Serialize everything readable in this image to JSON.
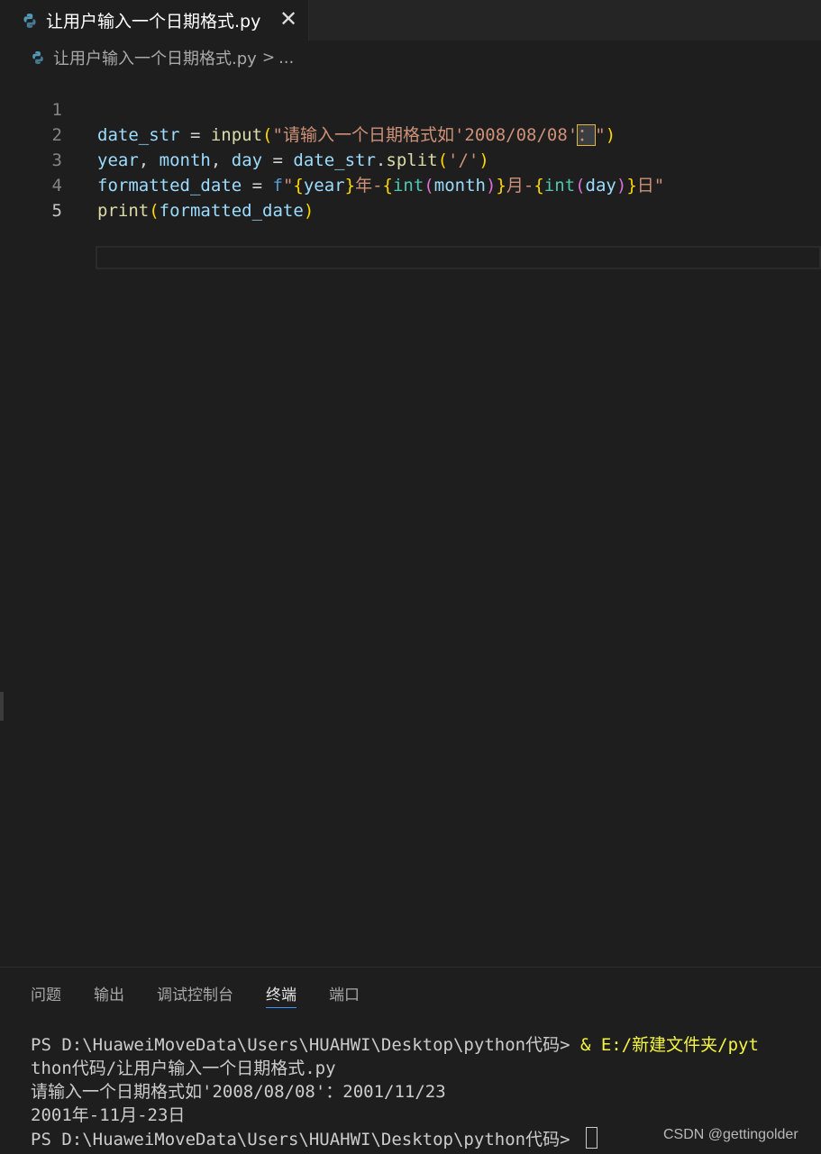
{
  "tab": {
    "title": "让用户输入一个日期格式.py",
    "close_glyph": "✕"
  },
  "breadcrumb": {
    "file": "让用户输入一个日期格式.py",
    "separator": ">",
    "more": "..."
  },
  "editor": {
    "line_numbers": [
      "1",
      "2",
      "3",
      "4",
      "5"
    ],
    "lines": {
      "l1": {
        "a": "date_str",
        "b": " = ",
        "c": "input",
        "d": "(",
        "e": "\"请输入一个日期格式如'2008/08/08'",
        "f": "：",
        "g": "\"",
        "h": ")"
      },
      "l2": {
        "a": "year",
        "b": ", ",
        "c": "month",
        "d": ", ",
        "e": "day",
        "f": " = ",
        "g": "date_str",
        "h": ".",
        "i": "split",
        "j": "(",
        "k": "'/'",
        "l": ")"
      },
      "l3": {
        "a": "formatted_date",
        "b": " = ",
        "c": "f",
        "d": "\"",
        "e": "{",
        "f": "year",
        "g": "}",
        "h": "年-",
        "i": "{",
        "j": "int",
        "k": "(",
        "l": "month",
        "m": ")",
        "n": "}",
        "o": "月-",
        "p": "{",
        "q": "int",
        "r": "(",
        "s": "day",
        "t": ")",
        "u": "}",
        "v": "日\""
      },
      "l4": {
        "a": "print",
        "b": "(",
        "c": "formatted_date",
        "d": ")"
      }
    }
  },
  "panel": {
    "tabs": [
      "问题",
      "输出",
      "调试控制台",
      "终端",
      "端口"
    ],
    "active_tab": "终端",
    "terminal": {
      "l1_a": "PS D:\\HuaweiMoveData\\Users\\HUAHWI\\Desktop\\python代码> ",
      "l1_b": "& E:/新建文件夹/pyt",
      "l2": "thon代码/让用户输入一个日期格式.py",
      "l3": "请输入一个日期格式如'2008/08/08'：2001/11/23",
      "l4": "2001年-11月-23日",
      "l5": "PS D:\\HuaweiMoveData\\Users\\HUAHWI\\Desktop\\python代码> "
    }
  },
  "watermark": "CSDN @gettingolder",
  "icons": {
    "file": "python-icon"
  }
}
